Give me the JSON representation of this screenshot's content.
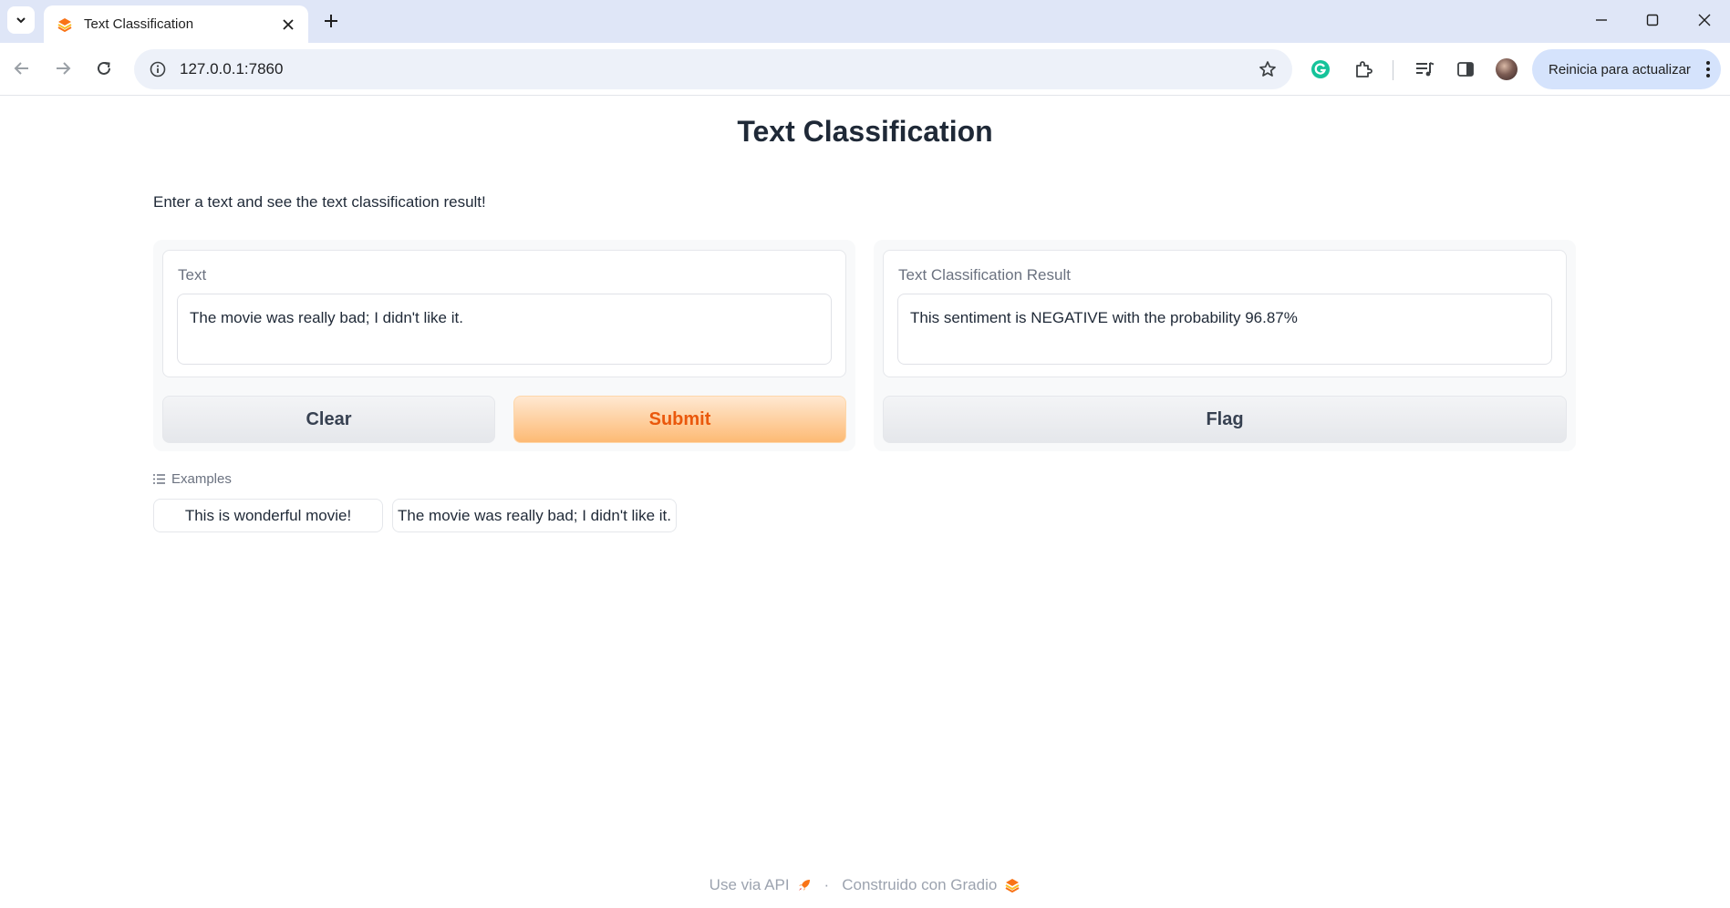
{
  "browser": {
    "tab_title": "Text Classification",
    "url": "127.0.0.1:7860",
    "update_button_label": "Reinicia para actualizar",
    "icons": [
      "tab-search-icon",
      "gradio-favicon-icon",
      "close-tab-icon",
      "new-tab-icon",
      "minimize-icon",
      "maximize-icon",
      "close-window-icon",
      "back-icon",
      "forward-icon",
      "reload-icon",
      "site-info-icon",
      "bookmark-star-icon",
      "grammarly-icon",
      "extensions-icon",
      "media-controls-icon",
      "side-panel-icon",
      "profile-avatar",
      "menu-dots-icon"
    ]
  },
  "page": {
    "title": "Text Classification",
    "description": "Enter a text and see the text classification result!"
  },
  "input": {
    "label": "Text",
    "value": "The movie was really bad; I didn't like it."
  },
  "output": {
    "label": "Text Classification Result",
    "value": "This sentiment is NEGATIVE with the probability 96.87%"
  },
  "buttons": {
    "clear": "Clear",
    "submit": "Submit",
    "flag": "Flag"
  },
  "examples": {
    "label": "Examples",
    "items": [
      "This is wonderful movie!",
      "The movie was really bad; I didn't like it."
    ]
  },
  "footer": {
    "api_link": "Use via API",
    "separator": "·",
    "built_with": "Construido con Gradio"
  },
  "colors": {
    "accent": "#ea580c",
    "submit_gradient_start": "#ffe8d1",
    "submit_gradient_end": "#fdba74",
    "tabstrip": "#dfe6f7"
  }
}
